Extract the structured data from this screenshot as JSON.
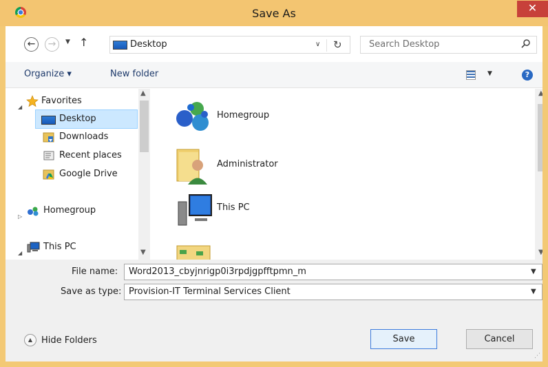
{
  "window": {
    "title": "Save As",
    "close_label": "✕"
  },
  "nav": {
    "back": "←",
    "forward": "→",
    "dropdown": "▼",
    "up": "↑"
  },
  "address": {
    "location": "Desktop",
    "chevron": "∨",
    "refresh": "↻"
  },
  "search": {
    "placeholder": "Search Desktop"
  },
  "toolbar": {
    "organize": "Organize ▾",
    "new_folder": "New folder",
    "views_dropdown": "▼",
    "help": "?"
  },
  "tree": {
    "favorites": "Favorites",
    "desktop": "Desktop",
    "downloads": "Downloads",
    "recent_places": "Recent places",
    "google_drive": "Google Drive",
    "homegroup": "Homegroup",
    "this_pc": "This PC"
  },
  "content": {
    "items": [
      "Homegroup",
      "Administrator",
      "This PC"
    ]
  },
  "form": {
    "file_name_label": "File name:",
    "file_name_value": "Word2013_cbyjnrigp0i3rpdjgpfftpmn_m",
    "save_type_label": "Save as type:",
    "save_type_value": "Provision-IT Terminal Services Client"
  },
  "footer": {
    "hide_folders": "Hide Folders",
    "save": "Save",
    "cancel": "Cancel"
  },
  "colors": {
    "title_bar": "#f3c571",
    "close": "#c7413a",
    "selection": "#cce8ff"
  }
}
